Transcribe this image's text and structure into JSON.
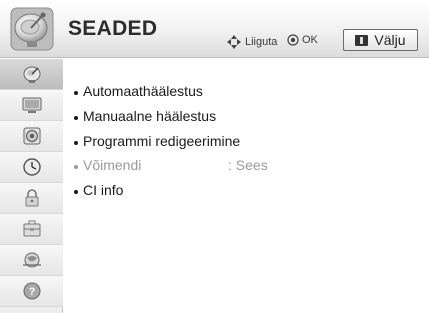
{
  "header": {
    "title": "SEADED",
    "icon": "settings-satellite-dish-icon",
    "hint_move_label": "Liiguta",
    "hint_ok_label": "OK",
    "exit_label": "Välju"
  },
  "sidebar": {
    "items": [
      {
        "icon": "satellite-dish-icon",
        "active": true
      },
      {
        "icon": "monitor-icon",
        "active": false
      },
      {
        "icon": "speaker-icon",
        "active": false
      },
      {
        "icon": "clock-icon",
        "active": false
      },
      {
        "icon": "lock-icon",
        "active": false
      },
      {
        "icon": "toolbox-icon",
        "active": false
      },
      {
        "icon": "network-globe-icon",
        "active": false
      },
      {
        "icon": "help-icon",
        "active": false
      }
    ]
  },
  "menu": {
    "items": [
      {
        "label": "Automaathäälestus",
        "value": "",
        "enabled": true
      },
      {
        "label": "Manuaalne häälestus",
        "value": "",
        "enabled": true
      },
      {
        "label": "Programmi redigeerimine",
        "value": "",
        "enabled": true
      },
      {
        "label": "Võimendi",
        "value": ": Sees",
        "enabled": false
      },
      {
        "label": "CI info",
        "value": "",
        "enabled": true
      }
    ]
  },
  "colors": {
    "text": "#1a1a1a",
    "disabled_text": "#9a9a9a",
    "sidebar_bg": "#eeeeee",
    "header_title": "#2c2c2c"
  }
}
